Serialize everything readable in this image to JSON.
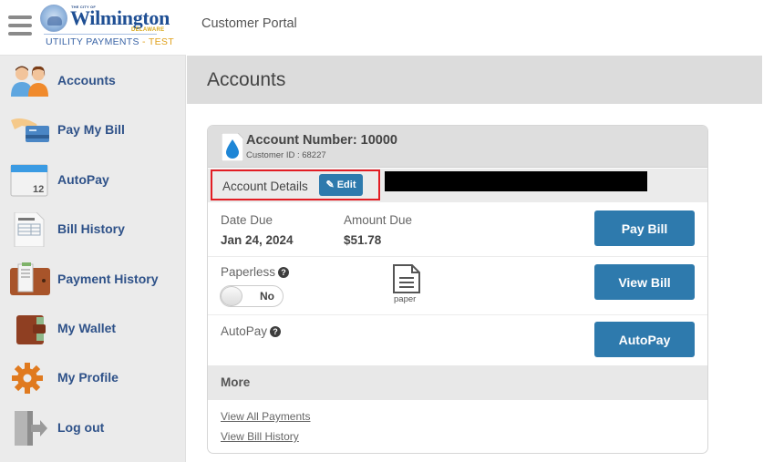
{
  "logo": {
    "city_of": "THE CITY OF",
    "city_name": "Wilmington",
    "state": "DELAWARE",
    "subtitle": "UTILITY PAYMENTS",
    "subtitle_sep": " - ",
    "env_tag": "TEST"
  },
  "header": {
    "portal_title": "Customer Portal",
    "page_title": "Accounts"
  },
  "sidebar": {
    "items": [
      {
        "label": "Accounts",
        "icon": "users-icon"
      },
      {
        "label": "Pay My Bill",
        "icon": "credit-card-hand-icon"
      },
      {
        "label": "AutoPay",
        "icon": "calendar-icon"
      },
      {
        "label": "Bill History",
        "icon": "invoice-icon"
      },
      {
        "label": "Payment History",
        "icon": "receipt-wallet-icon"
      },
      {
        "label": "My Wallet",
        "icon": "wallet-icon"
      },
      {
        "label": "My Profile",
        "icon": "gear-icon"
      },
      {
        "label": "Log out",
        "icon": "logout-door-icon"
      }
    ]
  },
  "account": {
    "number_label": "Account Number: 10000",
    "customer_id_label": "Customer ID : 68227",
    "details_label": "Account Details",
    "edit_label": "Edit",
    "date_due_label": "Date Due",
    "date_due_value": "Jan 24, 2024",
    "amount_due_label": "Amount Due",
    "amount_due_value": "$51.78",
    "pay_bill_label": "Pay Bill",
    "paperless_label": "Paperless",
    "paperless_toggle_value": "No",
    "paper_label": "paper",
    "view_bill_label": "View Bill",
    "autopay_label": "AutoPay",
    "autopay_button_label": "AutoPay",
    "help_glyph": "?",
    "more_label": "More",
    "links": [
      "View All Payments",
      "View Bill History"
    ]
  },
  "colors": {
    "primary_button": "#2e7aad",
    "highlight_border": "#e21d24",
    "nav_text": "#2f5289",
    "test_tag": "#e0a11b"
  }
}
